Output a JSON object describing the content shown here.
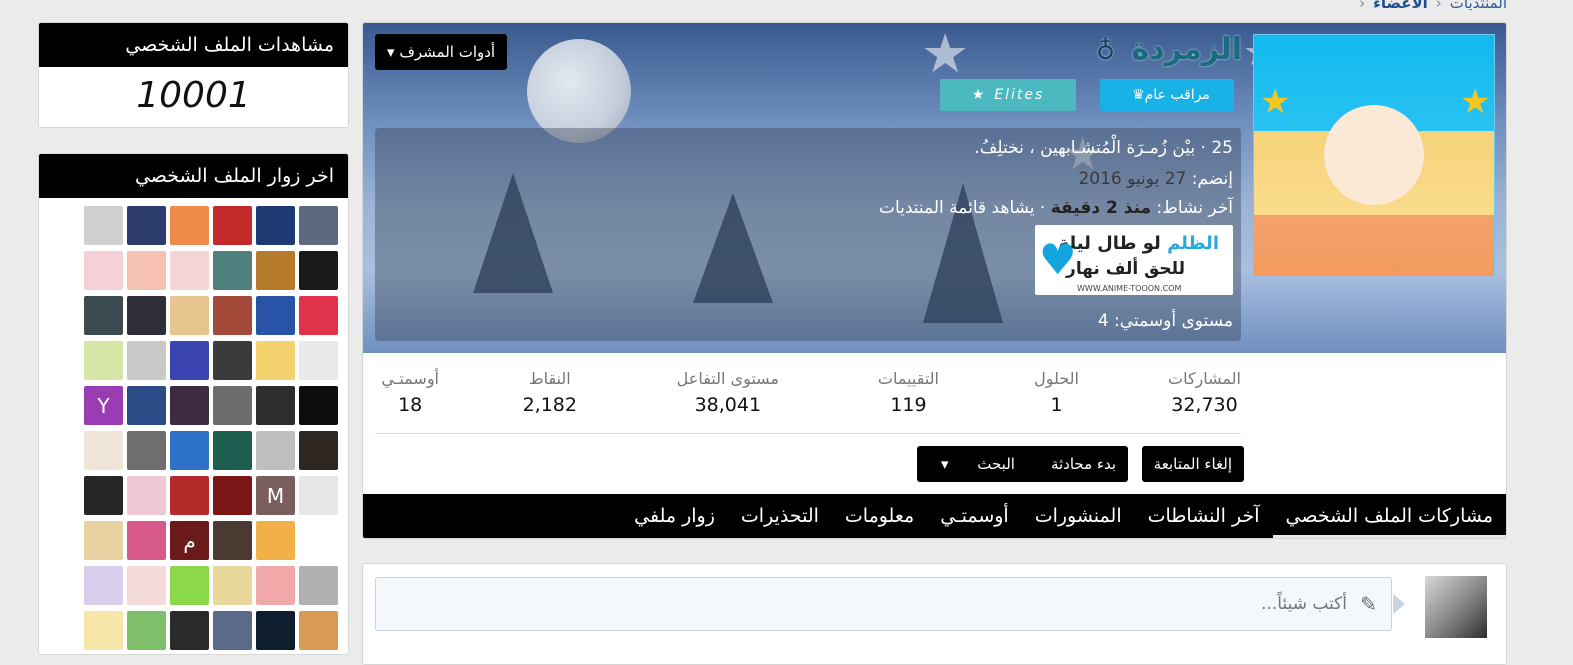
{
  "breadcrumb": {
    "items": [
      "المنتديات",
      "الأعضاء"
    ]
  },
  "sidebar": {
    "views_title": "مشاهدات الملف الشخصي",
    "views_count": "10001",
    "visitors_title": "اخر زوار الملف الشخصي",
    "visitors": [
      {
        "color": "#5b6a7c",
        "letter": ""
      },
      {
        "color": "#1d3a73",
        "letter": ""
      },
      {
        "color": "#c22a2a",
        "letter": ""
      },
      {
        "color": "#f08a4b",
        "letter": ""
      },
      {
        "color": "#2b3b6b",
        "letter": ""
      },
      {
        "color": "#cfcfcf",
        "letter": ""
      },
      {
        "color": "#1a1a1a",
        "letter": ""
      },
      {
        "color": "#b57a2a",
        "letter": ""
      },
      {
        "color": "#4f7f7f",
        "letter": ""
      },
      {
        "color": "#f4d6d6",
        "letter": ""
      },
      {
        "color": "#f7c1b4",
        "letter": ""
      },
      {
        "color": "#f6d0d8",
        "letter": ""
      },
      {
        "color": "#e0324a",
        "letter": ""
      },
      {
        "color": "#2853a7",
        "letter": ""
      },
      {
        "color": "#a44a3a",
        "letter": ""
      },
      {
        "color": "#e7c58f",
        "letter": ""
      },
      {
        "color": "#2e2e38",
        "letter": ""
      },
      {
        "color": "#3c4b4f",
        "letter": ""
      },
      {
        "color": "#e9e9e9",
        "letter": ""
      },
      {
        "color": "#f4d26d",
        "letter": ""
      },
      {
        "color": "#3b3b3b",
        "letter": ""
      },
      {
        "color": "#3a45b2",
        "letter": ""
      },
      {
        "color": "#c9c9c9",
        "letter": ""
      },
      {
        "color": "#d5e6a7",
        "letter": ""
      },
      {
        "color": "#0d0d0d",
        "letter": ""
      },
      {
        "color": "#2d2d2d",
        "letter": ""
      },
      {
        "color": "#6d6d6d",
        "letter": ""
      },
      {
        "color": "#3d2b3f",
        "letter": ""
      },
      {
        "color": "#2b4b86",
        "letter": ""
      },
      {
        "color": "#9b3db2",
        "letter": "Y"
      },
      {
        "color": "#2e2721",
        "letter": ""
      },
      {
        "color": "#bfbfbf",
        "letter": ""
      },
      {
        "color": "#1c5e4f",
        "letter": ""
      },
      {
        "color": "#2d72c8",
        "letter": ""
      },
      {
        "color": "#6e6e6e",
        "letter": ""
      },
      {
        "color": "#efe4d8",
        "letter": ""
      },
      {
        "color": "#e7e7e7",
        "letter": ""
      },
      {
        "color": "#7b5e5e",
        "letter": "M"
      },
      {
        "color": "#7c1515",
        "letter": ""
      },
      {
        "color": "#b52a2a",
        "letter": ""
      },
      {
        "color": "#f0c8d8",
        "letter": ""
      },
      {
        "color": "#272727",
        "letter": ""
      },
      {
        "color": "#ffffff",
        "letter": ""
      },
      {
        "color": "#f2b049",
        "letter": ""
      },
      {
        "color": "#4a3a31",
        "letter": ""
      },
      {
        "color": "#6a1a1a",
        "letter": "م"
      },
      {
        "color": "#d85a8a",
        "letter": ""
      },
      {
        "color": "#e8d2a2",
        "letter": ""
      },
      {
        "color": "#b0b0b0",
        "letter": ""
      },
      {
        "color": "#f0a8a8",
        "letter": ""
      },
      {
        "color": "#e9d89c",
        "letter": ""
      },
      {
        "color": "#8bd84a",
        "letter": ""
      },
      {
        "color": "#f5dada",
        "letter": ""
      },
      {
        "color": "#d8cdea",
        "letter": ""
      },
      {
        "color": "#d99a55",
        "letter": ""
      },
      {
        "color": "#0f1e2e",
        "letter": ""
      },
      {
        "color": "#5a6b8a",
        "letter": ""
      },
      {
        "color": "#2a2a2a",
        "letter": ""
      },
      {
        "color": "#7fbf6a",
        "letter": ""
      },
      {
        "color": "#f6e6a8",
        "letter": ""
      }
    ]
  },
  "profile": {
    "tools_label": "أدوات المشرف",
    "username": "الزمردة",
    "gender_icon": "♁",
    "badges": {
      "moderator": "مراقب عام",
      "elites": "Elites"
    },
    "custom_title": "25 · بيْن زُمـرَة الْمُتشـابهين ، نختلِفُ.",
    "joined_label": "إنضم:",
    "joined_value": "27 يونيو 2016",
    "last_activity_label": "آخر نشاط:",
    "last_activity_value": "منذ 2 دقيقة",
    "last_activity_detail": "· يشاهد قائمة المنتديات",
    "signature": {
      "line1_blue": "الظلم",
      "line1_rest": "لو طال ليلة",
      "line2": "للحق ألف نهار",
      "url": "WWW.ANIME-TOOON.COM"
    },
    "level_label": "مستوى أوسمتي:",
    "level_value": "4",
    "stats": [
      {
        "label": "المشاركات",
        "value": "32,730"
      },
      {
        "label": "الحلول",
        "value": "1"
      },
      {
        "label": "التقييمات",
        "value": "119"
      },
      {
        "label": "مستوى التفاعل",
        "value": "38,041"
      },
      {
        "label": "النقاط",
        "value": "2,182"
      },
      {
        "label": "أوسمتـي",
        "value": "18"
      }
    ],
    "buttons": {
      "unfollow": "إلغاء المتابعة",
      "start_conversation": "بدء محادثة",
      "search": "البحث"
    },
    "tabs": [
      "مشاركات الملف الشخصي",
      "آخر النشاطات",
      "المنشورات",
      "أوسمتـي",
      "معلومات",
      "التحذيرات",
      "زوار ملفي"
    ]
  },
  "composer": {
    "placeholder": "أكتب شيئاً..."
  },
  "colors": {
    "header_black": "#000000",
    "link_blue": "#2a5f9e",
    "banner_blue": "#6f8fbf",
    "accent_cyan": "#18b2e6"
  }
}
